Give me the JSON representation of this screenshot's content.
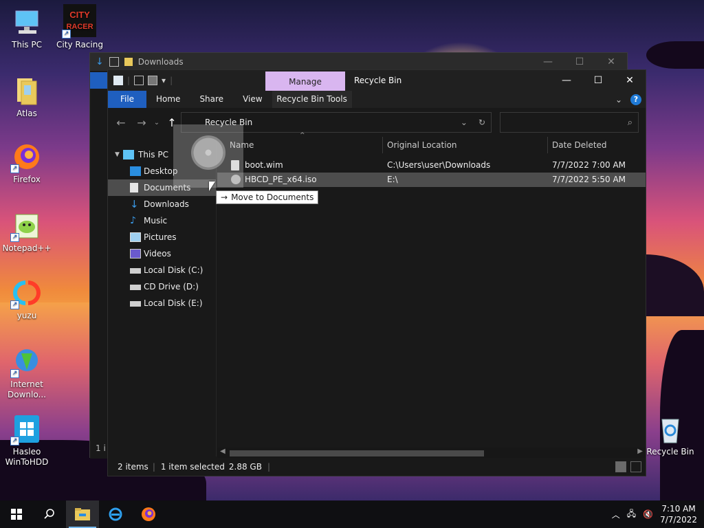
{
  "desktop_icons": [
    {
      "label": "This PC",
      "icon": "computer-icon"
    },
    {
      "label": "City Racing",
      "icon": "city-racer-icon"
    },
    {
      "label": "Atlas",
      "icon": "folder-icon"
    },
    {
      "label": "Firefox",
      "icon": "firefox-icon"
    },
    {
      "label": "Notepad++",
      "icon": "notepadpp-icon"
    },
    {
      "label": "yuzu",
      "icon": "yuzu-icon"
    },
    {
      "label": "Internet Downlo...",
      "icon": "idm-icon"
    },
    {
      "label": "Hasleo WinToHDD",
      "icon": "wintohdd-icon"
    },
    {
      "label": "Recycle Bin",
      "icon": "recycle-bin-icon"
    }
  ],
  "back_window": {
    "title": "Downloads",
    "status": "1 i"
  },
  "window": {
    "manage_tab": "Manage",
    "title": "Recycle Bin",
    "ribbon_tabs": [
      "File",
      "Home",
      "Share",
      "View",
      "Recycle Bin Tools"
    ],
    "address_breadcrumb": "Recycle Bin",
    "search_placeholder": ""
  },
  "nav_pane": {
    "items": [
      {
        "label": "This PC",
        "icon": "computer-icon"
      },
      {
        "label": "Desktop",
        "icon": "desktop-icon"
      },
      {
        "label": "Documents",
        "icon": "documents-icon"
      },
      {
        "label": "Downloads",
        "icon": "downloads-icon"
      },
      {
        "label": "Music",
        "icon": "music-icon"
      },
      {
        "label": "Pictures",
        "icon": "pictures-icon"
      },
      {
        "label": "Videos",
        "icon": "videos-icon"
      },
      {
        "label": "Local Disk (C:)",
        "icon": "disk-icon"
      },
      {
        "label": "CD Drive (D:)",
        "icon": "cd-drive-icon"
      },
      {
        "label": "Local Disk (E:)",
        "icon": "disk-icon"
      }
    ]
  },
  "columns": [
    "Name",
    "Original Location",
    "Date Deleted"
  ],
  "files": [
    {
      "name": "boot.wim",
      "location": "C:\\Users\\user\\Downloads",
      "date": "7/7/2022 7:00 AM"
    },
    {
      "name": "HBCD_PE_x64.iso",
      "location": "E:\\",
      "date": "7/7/2022 5:50 AM"
    }
  ],
  "drag_tooltip": "Move to Documents",
  "status": {
    "items": "2 items",
    "selected": "1 item selected",
    "size": "2.88 GB"
  },
  "taskbar": {
    "time": "7:10 AM",
    "date": "7/7/2022"
  },
  "colors": {
    "accent": "#1f5fbf",
    "manage_tab": "#d9b6f0",
    "selection": "#4d4d4d"
  }
}
